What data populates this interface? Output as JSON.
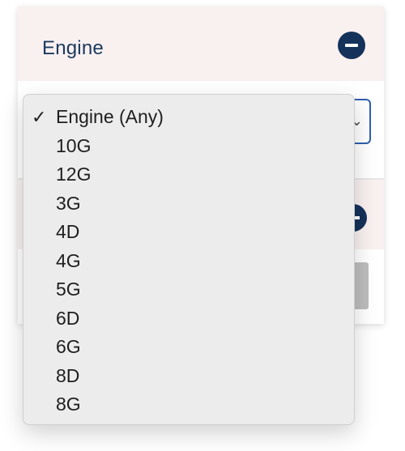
{
  "panel": {
    "title": "Engine",
    "collapse_icon": "minus-circle-icon"
  },
  "select": {
    "chevron_icon": "chevron-down-icon"
  },
  "dropdown": {
    "check_icon": "checkmark-icon",
    "selected_index": 0,
    "options": [
      {
        "label": "Engine (Any)"
      },
      {
        "label": "10G"
      },
      {
        "label": "12G"
      },
      {
        "label": "3G"
      },
      {
        "label": "4D"
      },
      {
        "label": "4G"
      },
      {
        "label": "5G"
      },
      {
        "label": "6D"
      },
      {
        "label": "6G"
      },
      {
        "label": "8D"
      },
      {
        "label": "8G"
      }
    ]
  },
  "colors": {
    "title_text": "#1b3a5f",
    "button_navy": "#15325a",
    "select_border": "#2f5fb0",
    "dropdown_bg": "#ececec",
    "header_bg": "#f9f0f0"
  }
}
